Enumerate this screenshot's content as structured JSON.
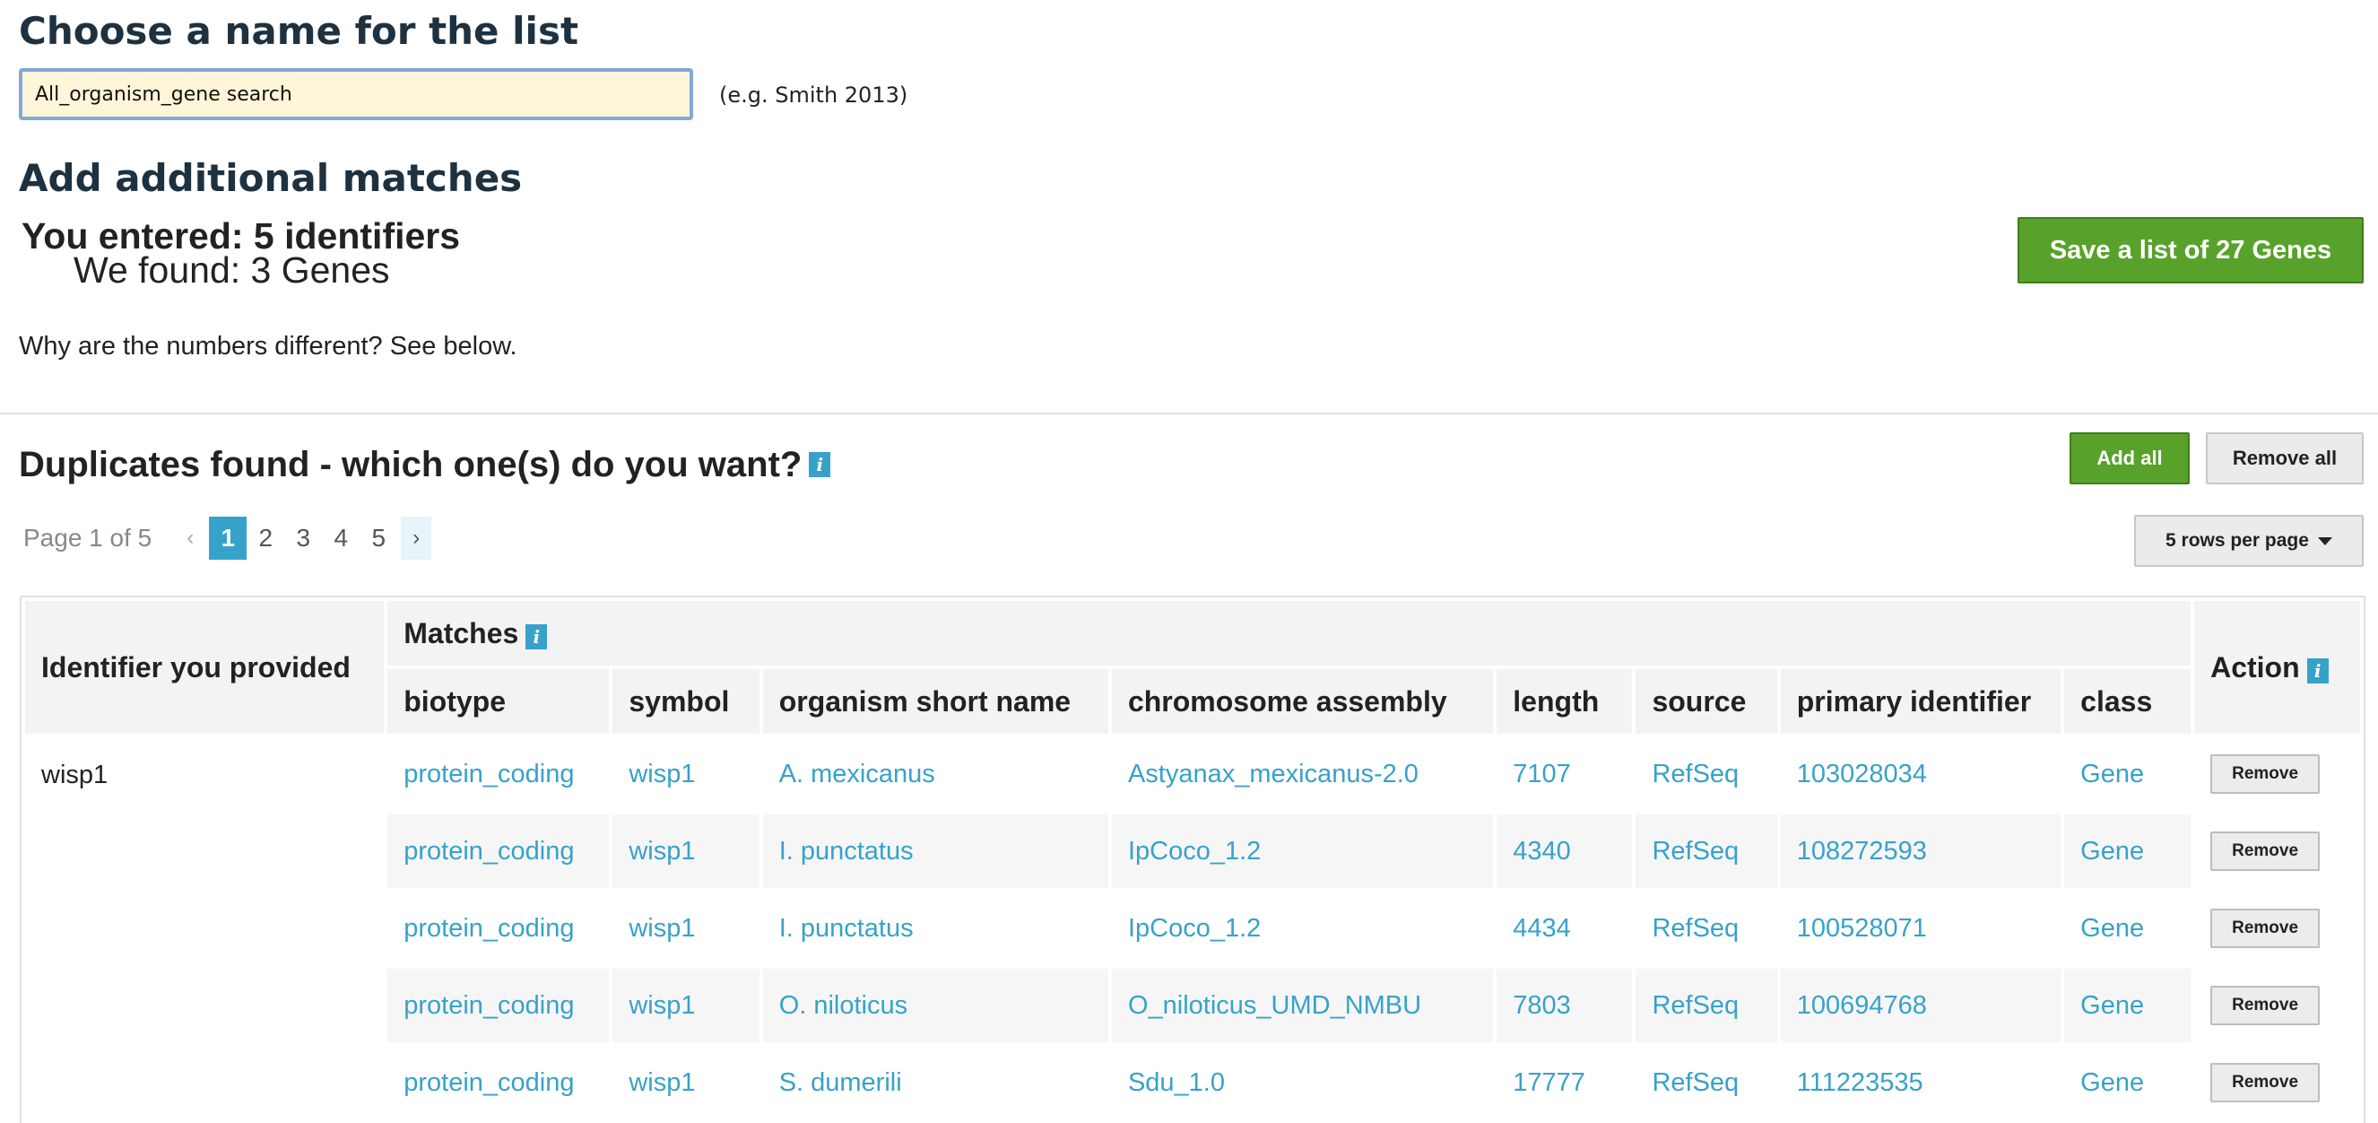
{
  "name_section": {
    "title": "Choose a name for the list",
    "input_value": "All_organism_gene search",
    "example": "(e.g. Smith 2013)"
  },
  "matches_section": {
    "title": "Add additional matches",
    "entered_text": "You entered: 5 identifiers",
    "found_text": "We found: 3 Genes",
    "save_button": "Save a list of 27 Genes",
    "why_text": "Why are the numbers different? See below."
  },
  "duplicates": {
    "title": "Duplicates found - which one(s) do you want?",
    "info_icon": "i",
    "add_all": "Add all",
    "remove_all": "Remove all",
    "rows_per_page": "5 rows per page",
    "pager": {
      "info": "Page 1 of 5",
      "prev": "‹",
      "pages": [
        "1",
        "2",
        "3",
        "4",
        "5"
      ],
      "current": "1",
      "next": "›"
    }
  },
  "table": {
    "identifier_header": "Identifier you provided",
    "matches_header": "Matches",
    "action_header": "Action",
    "columns": [
      "biotype",
      "symbol",
      "organism short name",
      "chromosome assembly",
      "length",
      "source",
      "primary identifier",
      "class"
    ],
    "identifier": "wisp1",
    "remove_label": "Remove",
    "rows": [
      [
        "protein_coding",
        "wisp1",
        "A. mexicanus",
        "Astyanax_mexicanus-2.0",
        "7107",
        "RefSeq",
        "103028034",
        "Gene"
      ],
      [
        "protein_coding",
        "wisp1",
        "I. punctatus",
        "IpCoco_1.2",
        "4340",
        "RefSeq",
        "108272593",
        "Gene"
      ],
      [
        "protein_coding",
        "wisp1",
        "I. punctatus",
        "IpCoco_1.2",
        "4434",
        "RefSeq",
        "100528071",
        "Gene"
      ],
      [
        "protein_coding",
        "wisp1",
        "O. niloticus",
        "O_niloticus_UMD_NMBU",
        "7803",
        "RefSeq",
        "100694768",
        "Gene"
      ],
      [
        "protein_coding",
        "wisp1",
        "S. dumerili",
        "Sdu_1.0",
        "17777",
        "RefSeq",
        "111223535",
        "Gene"
      ]
    ]
  },
  "colors": {
    "accent": "#37a2c9",
    "success": "#58a22c",
    "heading": "#1e3140",
    "input_bg": "#fff5d8"
  }
}
